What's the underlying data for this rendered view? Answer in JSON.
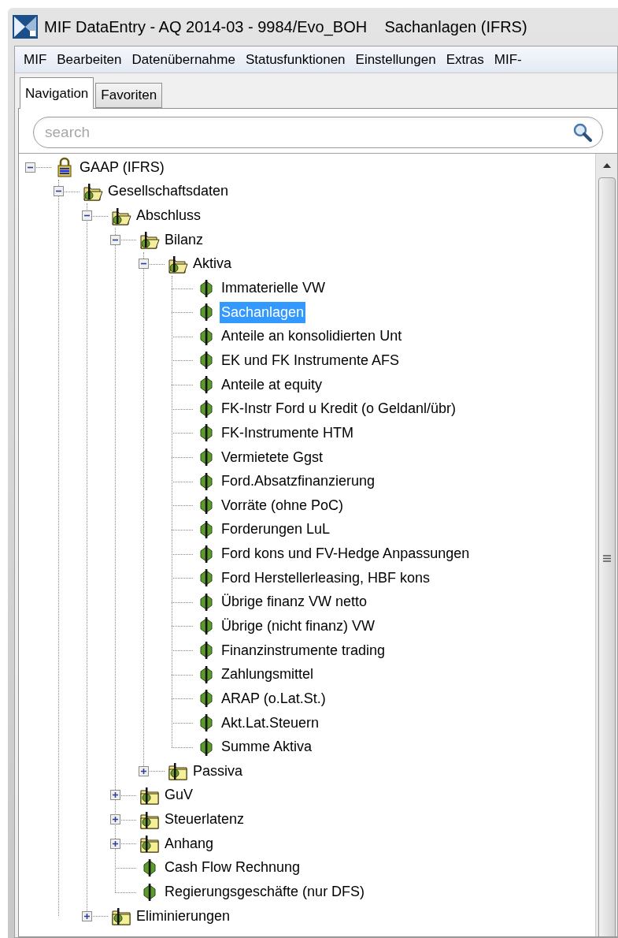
{
  "window": {
    "title": "MIF DataEntry - AQ 2014-03 - 9984/Evo_BOH    Sachanlagen (IFRS)"
  },
  "menu": [
    "MIF",
    "Bearbeiten",
    "Datenübernahme",
    "Statusfunktionen",
    "Einstellungen",
    "Extras",
    "MIF-"
  ],
  "tabs": [
    {
      "label": "Navigation",
      "selected": true
    },
    {
      "label": "Favoriten",
      "selected": false
    }
  ],
  "search": {
    "placeholder": "search"
  },
  "tree": [
    {
      "label": "GAAP (IFRS)",
      "kind": "lock",
      "expanded": true,
      "selected": false,
      "children": [
        {
          "label": "Gesellschaftsdaten",
          "kind": "folder",
          "expanded": true,
          "selected": false,
          "children": [
            {
              "label": "Abschluss",
              "kind": "folder",
              "expanded": true,
              "selected": false,
              "children": [
                {
                  "label": "Bilanz",
                  "kind": "folder",
                  "expanded": true,
                  "selected": false,
                  "children": [
                    {
                      "label": "Aktiva",
                      "kind": "folder",
                      "expanded": true,
                      "selected": false,
                      "children": [
                        {
                          "label": "Immaterielle VW",
                          "kind": "leaf",
                          "selected": false
                        },
                        {
                          "label": "Sachanlagen",
                          "kind": "leaf",
                          "selected": true
                        },
                        {
                          "label": "Anteile an konsolidierten Unt",
                          "kind": "leaf",
                          "selected": false
                        },
                        {
                          "label": "EK und FK Instrumente AFS",
                          "kind": "leaf",
                          "selected": false
                        },
                        {
                          "label": "Anteile at equity",
                          "kind": "leaf",
                          "selected": false
                        },
                        {
                          "label": "FK-Instr Ford u Kredit (o Geldanl/übr)",
                          "kind": "leaf",
                          "selected": false
                        },
                        {
                          "label": "FK-Instrumente HTM",
                          "kind": "leaf",
                          "selected": false
                        },
                        {
                          "label": "Vermietete Ggst",
                          "kind": "leaf",
                          "selected": false
                        },
                        {
                          "label": "Ford.Absatzfinanzierung",
                          "kind": "leaf",
                          "selected": false
                        },
                        {
                          "label": "Vorräte (ohne PoC)",
                          "kind": "leaf",
                          "selected": false
                        },
                        {
                          "label": "Forderungen LuL",
                          "kind": "leaf",
                          "selected": false
                        },
                        {
                          "label": "Ford kons und FV-Hedge Anpassungen",
                          "kind": "leaf",
                          "selected": false
                        },
                        {
                          "label": "Ford Herstellerleasing, HBF kons",
                          "kind": "leaf",
                          "selected": false
                        },
                        {
                          "label": "Übrige finanz VW netto",
                          "kind": "leaf",
                          "selected": false
                        },
                        {
                          "label": "Übrige (nicht finanz) VW",
                          "kind": "leaf",
                          "selected": false
                        },
                        {
                          "label": "Finanzinstrumente trading",
                          "kind": "leaf",
                          "selected": false
                        },
                        {
                          "label": "Zahlungsmittel",
                          "kind": "leaf",
                          "selected": false
                        },
                        {
                          "label": "ARAP (o.Lat.St.)",
                          "kind": "leaf",
                          "selected": false
                        },
                        {
                          "label": "Akt.Lat.Steuern",
                          "kind": "leaf",
                          "selected": false
                        },
                        {
                          "label": "Summe Aktiva",
                          "kind": "leaf",
                          "selected": false
                        }
                      ]
                    },
                    {
                      "label": "Passiva",
                      "kind": "folder",
                      "expanded": false,
                      "selected": false
                    }
                  ]
                },
                {
                  "label": "GuV",
                  "kind": "folder",
                  "expanded": false,
                  "selected": false
                },
                {
                  "label": "Steuerlatenz",
                  "kind": "folder",
                  "expanded": false,
                  "selected": false
                },
                {
                  "label": "Anhang",
                  "kind": "folder",
                  "expanded": false,
                  "selected": false
                },
                {
                  "label": "Cash Flow Rechnung",
                  "kind": "leaf",
                  "selected": false
                },
                {
                  "label": "Regierungsgeschäfte (nur DFS)",
                  "kind": "leaf",
                  "selected": false
                }
              ]
            },
            {
              "label": "Eliminierungen",
              "kind": "folder",
              "expanded": false,
              "selected": false
            }
          ]
        }
      ]
    }
  ]
}
